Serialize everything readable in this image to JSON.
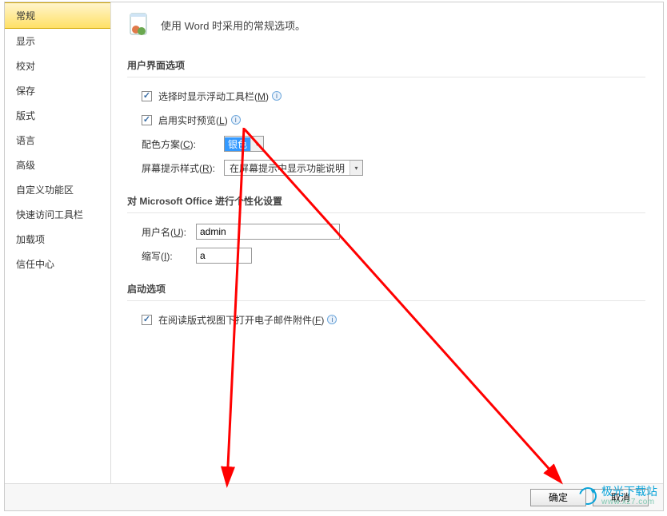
{
  "sidebar": {
    "items": [
      {
        "label": "常规",
        "active": true
      },
      {
        "label": "显示"
      },
      {
        "label": "校对"
      },
      {
        "label": "保存"
      },
      {
        "label": "版式"
      },
      {
        "label": "语言"
      },
      {
        "label": "高级"
      },
      {
        "label": "自定义功能区"
      },
      {
        "label": "快速访问工具栏"
      },
      {
        "label": "加载项"
      },
      {
        "label": "信任中心"
      }
    ]
  },
  "header": {
    "text": "使用 Word 时采用的常规选项。"
  },
  "sections": {
    "ui_options": {
      "title": "用户界面选项",
      "mini_toolbar_label": "选择时显示浮动工具栏(",
      "mini_toolbar_mn": "M",
      "close_paren": ")",
      "live_preview_label": "启用实时预览(",
      "live_preview_mn": "L",
      "color_scheme_label": "配色方案(",
      "color_scheme_mn": "C",
      "colon": "):",
      "color_scheme_value": "银色",
      "screentip_label": "屏幕提示样式(",
      "screentip_mn": "R",
      "screentip_value": "在屏幕提示中显示功能说明"
    },
    "personalize": {
      "title": "对 Microsoft Office 进行个性化设置",
      "username_label": "用户名(",
      "username_mn": "U",
      "username_value": "admin",
      "initials_label": "缩写(",
      "initials_mn": "I",
      "initials_value": "a"
    },
    "startup": {
      "title": "启动选项",
      "open_email_label": "在阅读版式视图下打开电子邮件附件(",
      "open_email_mn": "F"
    }
  },
  "footer": {
    "ok": "确定",
    "cancel": "取消"
  },
  "watermark": {
    "title": "极光下载站",
    "url": "www.xz7.com"
  }
}
